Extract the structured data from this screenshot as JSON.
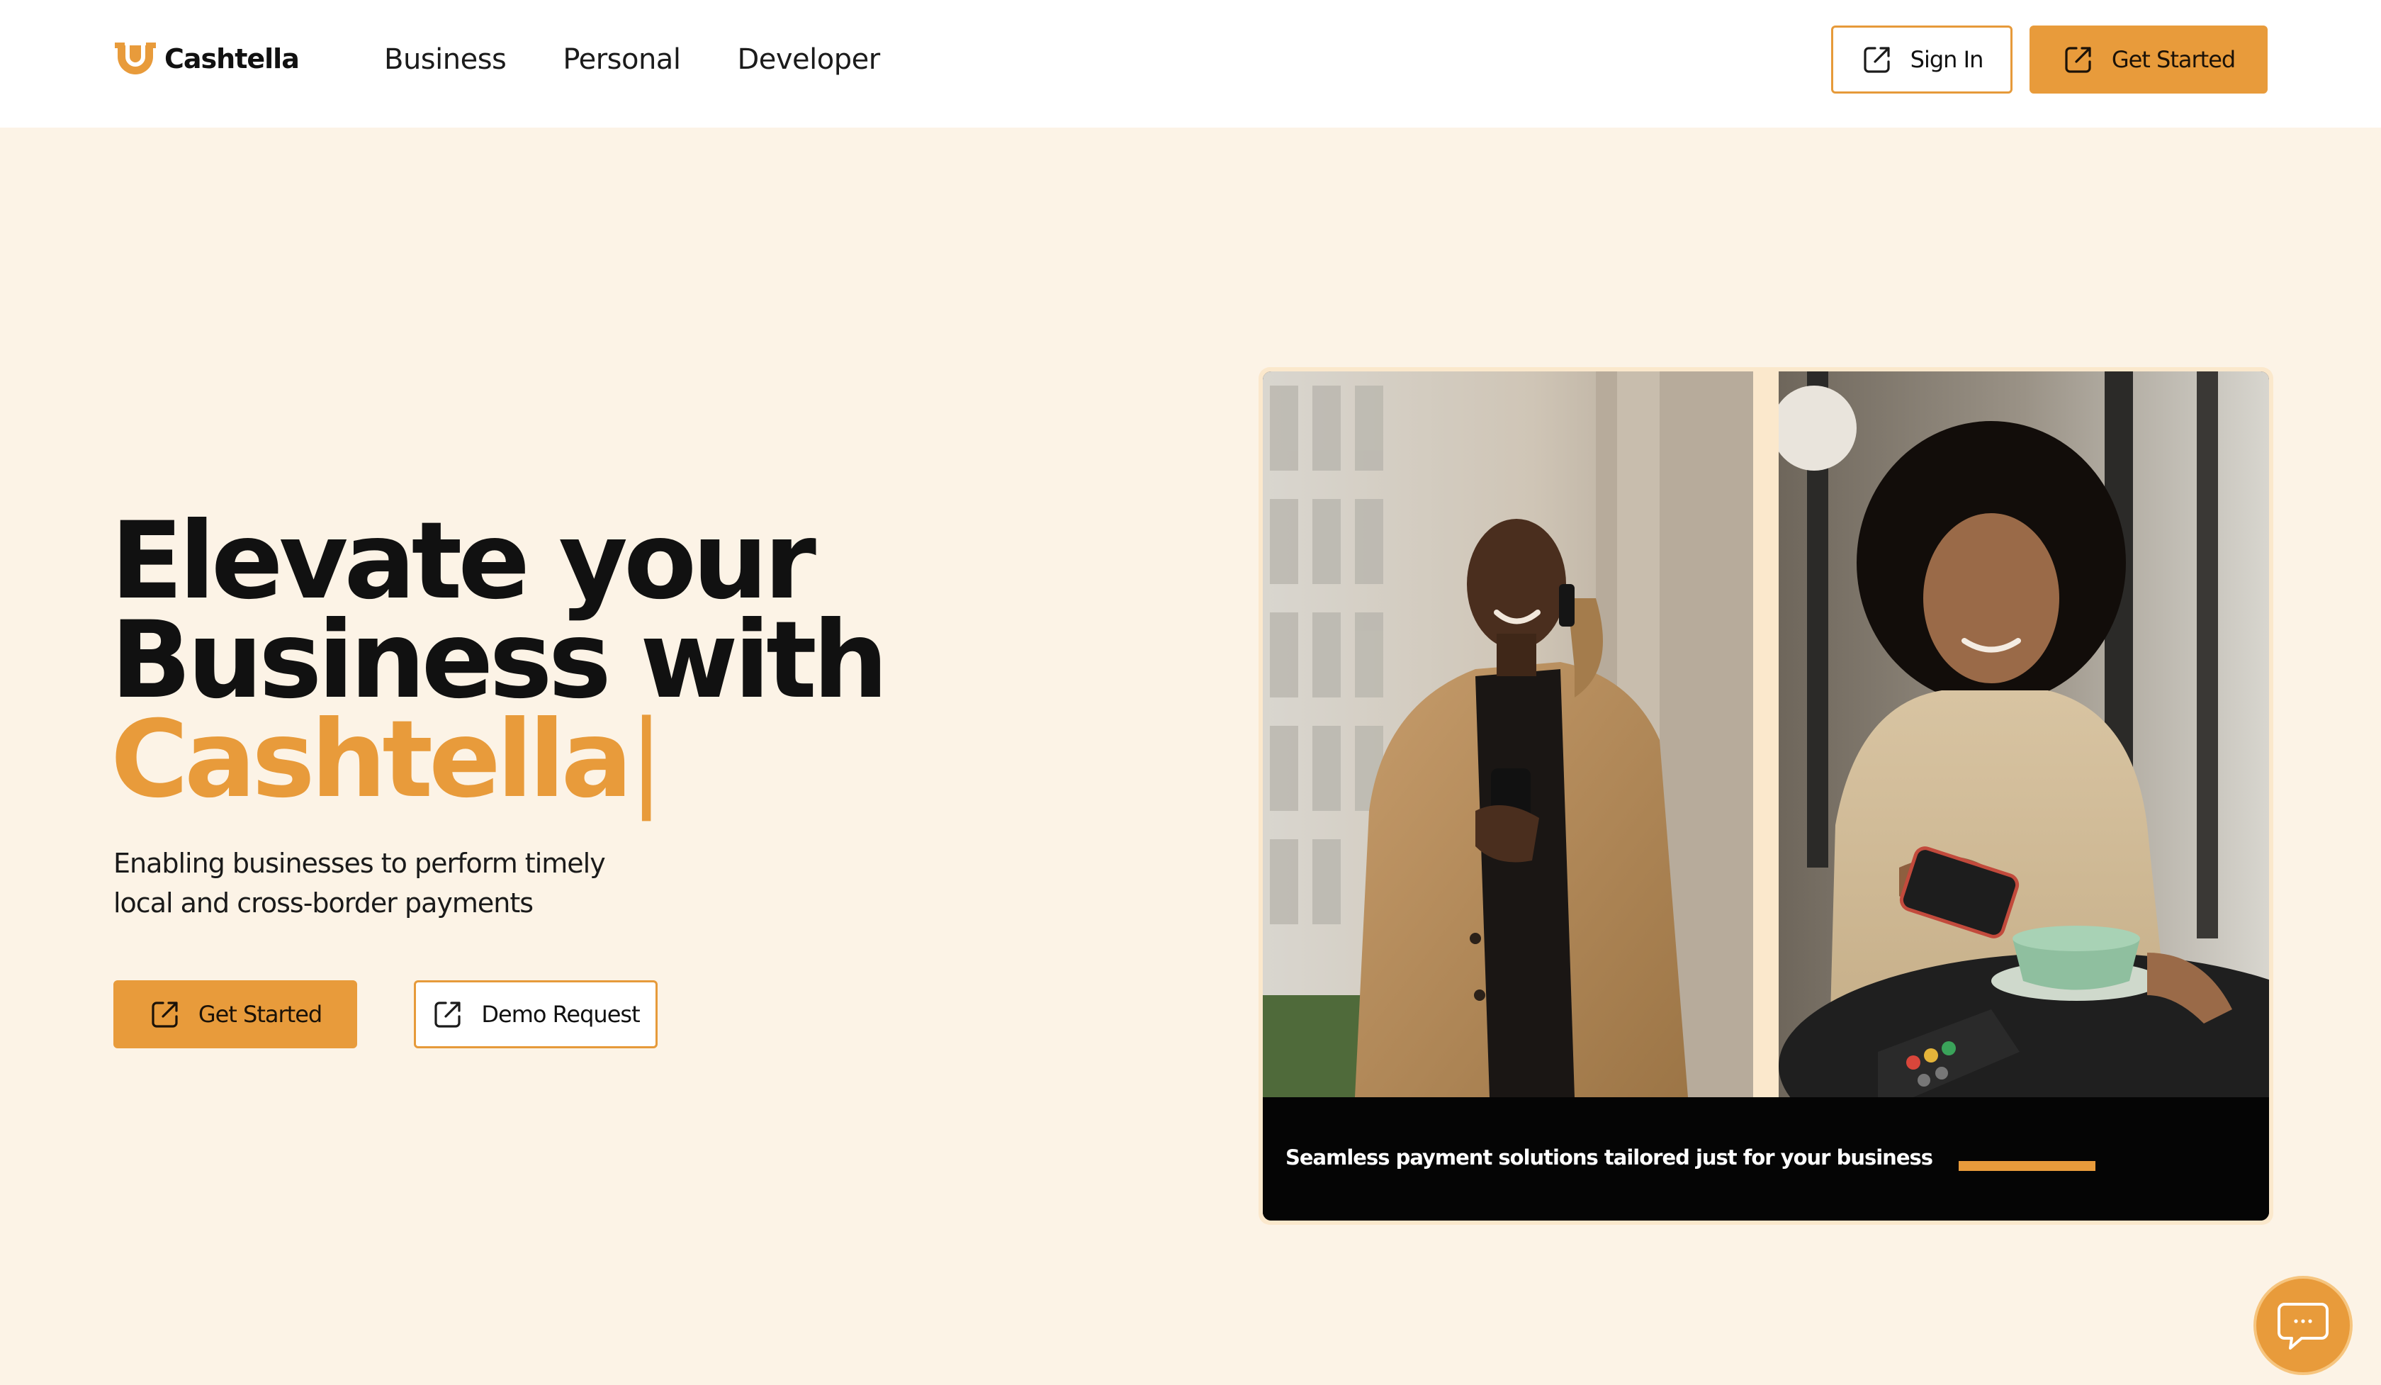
{
  "brand": {
    "name": "Cashtella",
    "accent_color": "#e89b3b",
    "background_color": "#fcf3e6"
  },
  "nav": {
    "links": [
      "Business",
      "Personal",
      "Developer"
    ],
    "sign_in": "Sign In",
    "get_started": "Get Started"
  },
  "hero": {
    "title_bold": "Elevate",
    "title_rest_line1": " your",
    "title_line2": "Business with",
    "title_accent": "Cashtella",
    "caret": "|",
    "subtitle": "Enabling businesses to perform timely local and cross-border payments",
    "primary_cta": "Get Started",
    "secondary_cta": "Demo Request"
  },
  "carousel": {
    "caption": "Seamless payment solutions tailored just for your business",
    "progress": 0.35
  },
  "icons": {
    "external_link": "external-link-icon",
    "logo": "cashtella-logo-icon",
    "chat": "chat-bubble-icon"
  }
}
